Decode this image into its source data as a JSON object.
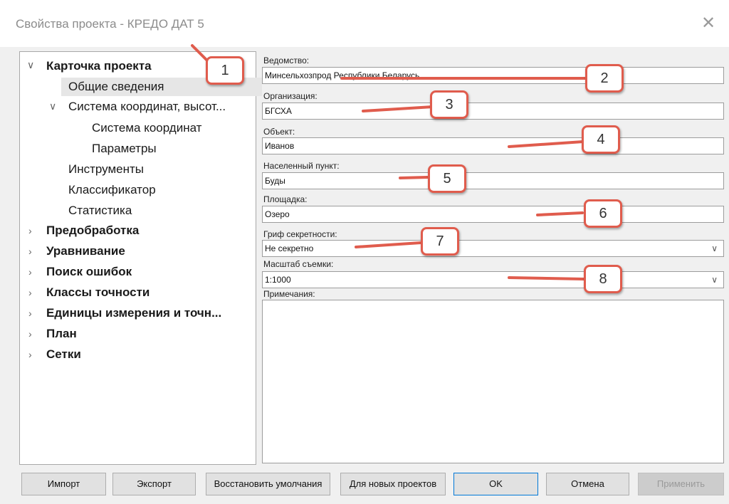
{
  "window": {
    "title": "Свойства проекта - КРЕДО ДАТ 5",
    "close_glyph": "✕"
  },
  "tree": {
    "items": [
      {
        "label": "Карточка проекта",
        "arrow": "expanded"
      },
      {
        "label": "Общие сведения"
      },
      {
        "label": "Система координат, высот...",
        "arrow": "expanded"
      },
      {
        "label": "Система координат"
      },
      {
        "label": "Параметры"
      },
      {
        "label": "Инструменты"
      },
      {
        "label": "Классификатор"
      },
      {
        "label": "Статистика"
      },
      {
        "label": "Предобработка",
        "arrow": "collapsed"
      },
      {
        "label": "Уравнивание",
        "arrow": "collapsed"
      },
      {
        "label": "Поиск ошибок",
        "arrow": "collapsed"
      },
      {
        "label": "Классы точности",
        "arrow": "collapsed"
      },
      {
        "label": "Единицы измерения и точн...",
        "arrow": "collapsed"
      },
      {
        "label": "План",
        "arrow": "collapsed"
      },
      {
        "label": "Сетки",
        "arrow": "collapsed"
      }
    ],
    "selected": "Общие сведения"
  },
  "form": {
    "department": {
      "label": "Ведомство:",
      "value": "Минсельхозпрод Республики Беларусь"
    },
    "organization": {
      "label": "Организация:",
      "value": "БГСХА"
    },
    "object": {
      "label": "Объект:",
      "value": "Иванов"
    },
    "settlement": {
      "label": "Населенный пункт:",
      "value": "Буды"
    },
    "site": {
      "label": "Площадка:",
      "value": "Озеро"
    },
    "secrecy": {
      "label": "Гриф секретности:",
      "value": "Не секретно"
    },
    "scale": {
      "label": "Масштаб съемки:",
      "value": "1:1000"
    },
    "notes": {
      "label": "Примечания:",
      "value": ""
    }
  },
  "buttons": {
    "import": "Импорт",
    "export": "Экспорт",
    "restore": "Восстановить умолчания",
    "for_new": "Для новых проектов",
    "ok": "OK",
    "cancel": "Отмена",
    "apply": "Применить"
  },
  "callouts": [
    "1",
    "2",
    "3",
    "4",
    "5",
    "6",
    "7",
    "8"
  ],
  "colors": {
    "callout_border": "#e05c4d",
    "selection": "#e6e6e6"
  }
}
